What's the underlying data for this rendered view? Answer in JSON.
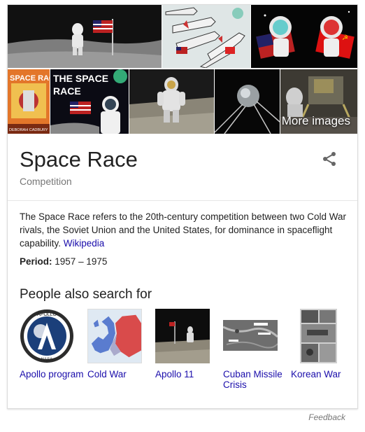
{
  "images": {
    "more_label": "More images",
    "tiles": [
      {
        "icon": "moonwalk-flag-photo"
      },
      {
        "icon": "rockets-cartoon"
      },
      {
        "icon": "cartoon-astronauts"
      },
      {
        "icon": "space-race-book-cover",
        "cover_text": "SPACE RACE",
        "cover_author": "DEBORAH CADBURY"
      },
      {
        "icon": "space-race-poster",
        "poster_text": [
          "THE SPACE",
          "RACE"
        ]
      },
      {
        "icon": "astronaut-moon-photo"
      },
      {
        "icon": "sputnik-photo"
      },
      {
        "icon": "lunar-module-photo"
      }
    ]
  },
  "entity": {
    "title": "Space Race",
    "subtitle": "Competition",
    "share_icon": "share-icon"
  },
  "description": {
    "text": "The Space Race refers to the 20th-century competition between two Cold War rivals, the Soviet Union and the United States, for dominance in spaceflight capability.",
    "source_link": "Wikipedia"
  },
  "facts": {
    "period_label": "Period:",
    "period_value": "1957 – 1975"
  },
  "people_also_search": {
    "heading": "People also search for",
    "items": [
      {
        "label": "Apollo program",
        "icon": "apollo-patch-image",
        "patch_text": "APOLLO",
        "patch_sub": "NASA"
      },
      {
        "label": "Cold War",
        "icon": "europe-map-image"
      },
      {
        "label": "Apollo 11",
        "icon": "moon-landing-image"
      },
      {
        "label": "Cuban Missile Crisis",
        "icon": "missile-site-image"
      },
      {
        "label": "Korean War",
        "icon": "war-photo-image"
      }
    ]
  },
  "footer": {
    "feedback": "Feedback"
  },
  "colors": {
    "link": "#1a0dab",
    "title": "#222222",
    "muted": "#777777",
    "border": "#dcdcdc"
  }
}
